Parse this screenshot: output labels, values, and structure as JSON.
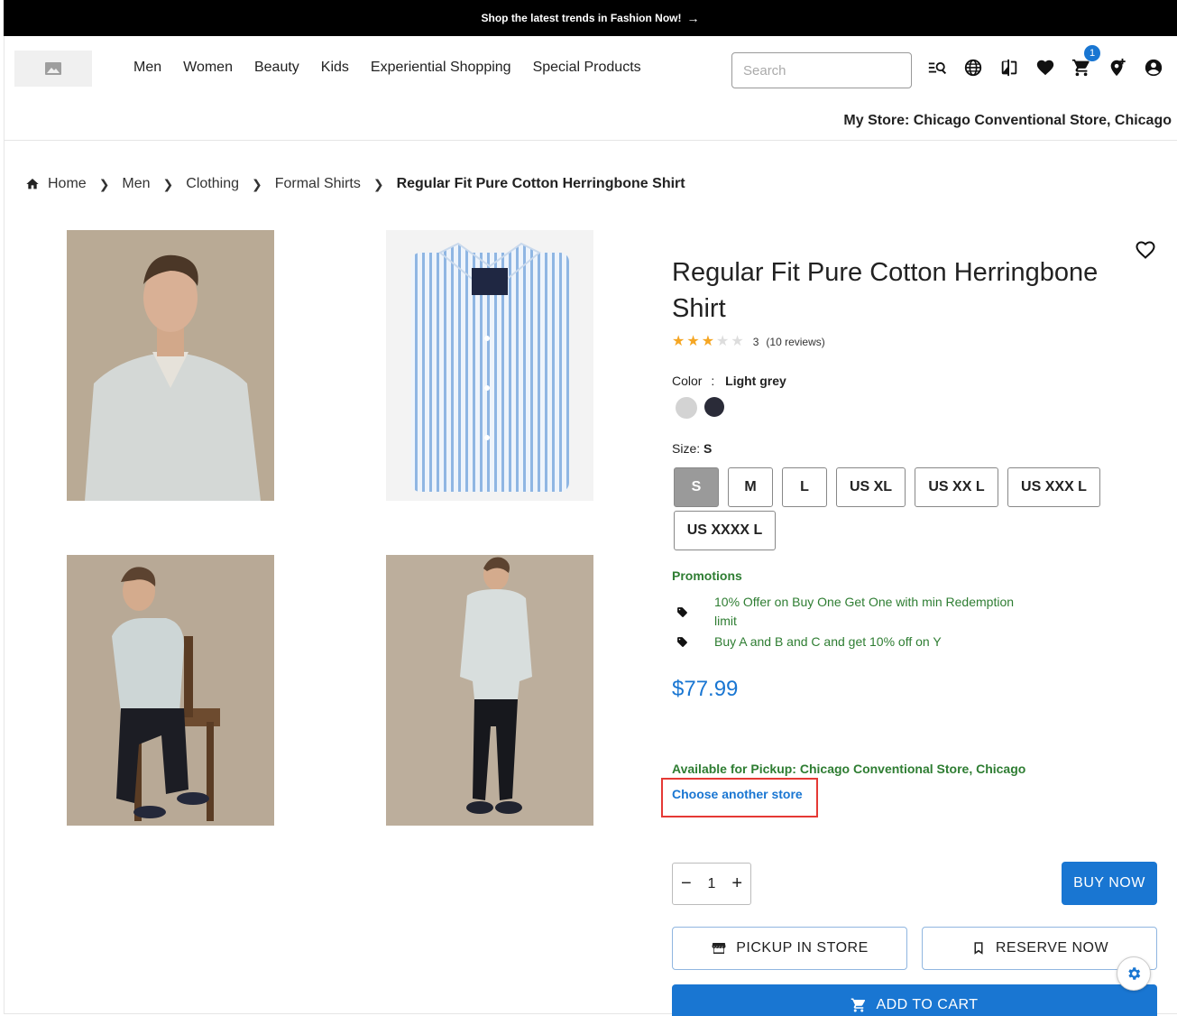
{
  "announcement": {
    "text": "Shop the latest trends in Fashion Now!",
    "arrow": "→"
  },
  "header": {
    "logo_icon": "image-placeholder-icon",
    "nav": [
      "Men",
      "Women",
      "Beauty",
      "Kids",
      "Experiential Shopping",
      "Special Products"
    ],
    "search_placeholder": "Search",
    "icons": [
      "visual-search-icon",
      "globe-icon",
      "compare-icon",
      "wishlist-heart-icon",
      "cart-icon",
      "add-location-icon",
      "account-icon"
    ],
    "cart_count": "1",
    "my_store": "My Store: Chicago Conventional Store, Chicago"
  },
  "breadcrumb": [
    "Home",
    "Men",
    "Clothing",
    "Formal Shirts",
    "Regular Fit Pure Cotton Herringbone Shirt"
  ],
  "product": {
    "title": "Regular Fit Pure Cotton Herringbone Shirt",
    "rating": 3,
    "rating_text": "3",
    "reviews": "(10 reviews)",
    "color_label": "Color",
    "color_sep": ":",
    "color_value": "Light grey",
    "swatches": [
      "#d3d3d3",
      "#2a2b38"
    ],
    "size_label": "Size:",
    "size_value": "S",
    "sizes": [
      "S",
      "M",
      "L",
      "US XL",
      "US XX L",
      "US XXX L",
      "US XXXX L"
    ],
    "promotions_title": "Promotions",
    "promotions": [
      "10% Offer on Buy One Get One with min Redemption limit",
      "Buy A and B and C and get 10% off on Y"
    ],
    "price": "$77.99",
    "pickup_text": "Available for Pickup: Chicago Conventional Store, Chicago",
    "choose_store": "Choose another store",
    "quantity": "1",
    "buy_now": "BUY NOW",
    "pickup_in_store": "PICKUP IN STORE",
    "reserve_now": "RESERVE NOW",
    "add_to_cart": "ADD TO CART"
  },
  "colors": {
    "accent": "#1976d2",
    "promo_green": "#2e7d32",
    "star": "#f5a623",
    "highlight": "#e53935"
  }
}
